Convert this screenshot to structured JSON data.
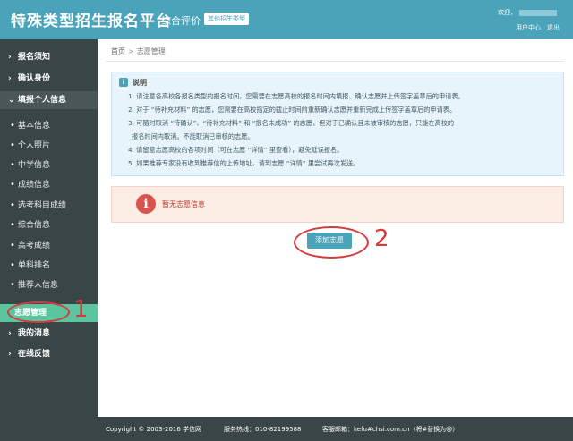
{
  "header": {
    "title": "特殊类型招生报名平台",
    "eval_label": "综合评价",
    "switch_type_label": "其他招生类型",
    "welcome_label": "欢迎，",
    "user_center_label": "用户中心",
    "logout_label": "退出"
  },
  "sidebar": {
    "items": [
      {
        "label": "报名须知",
        "kind": "top"
      },
      {
        "label": "确认身份",
        "kind": "top"
      },
      {
        "label": "填报个人信息",
        "kind": "top"
      },
      {
        "label": "基本信息",
        "kind": "sub"
      },
      {
        "label": "个人照片",
        "kind": "sub"
      },
      {
        "label": "中学信息",
        "kind": "sub"
      },
      {
        "label": "成绩信息",
        "kind": "sub"
      },
      {
        "label": "选考科目成绩",
        "kind": "sub"
      },
      {
        "label": "综合信息",
        "kind": "sub"
      },
      {
        "label": "高考成绩",
        "kind": "sub"
      },
      {
        "label": "单科排名",
        "kind": "sub"
      },
      {
        "label": "推荐人信息",
        "kind": "sub"
      },
      {
        "label": "志愿管理",
        "kind": "active"
      },
      {
        "label": "我的消息",
        "kind": "top"
      },
      {
        "label": "在线反馈",
        "kind": "top"
      }
    ]
  },
  "breadcrumb": {
    "home": "首页",
    "separator": ">",
    "current": "志愿管理"
  },
  "notice": {
    "title": "说明",
    "lines": [
      "1. 请注意各高校各报名类型的报名时间，您需要在志愿高校的报名时间内填报、确认志愿并上传签字盖章后的申请表。",
      "2. 对于 “待补充材料” 的志愿，您需要在高校指定的截止时间前重新确认志愿并重新完成上传签字盖章后的申请表。",
      "3. 可随时取消 “待确认”、“待补充材料” 和 “报名未成功” 的志愿，但对于已确认且未被审核的志愿，只能在高校的",
      "报名时间内取消。不能取消已审核的志愿。",
      "4. 请留意志愿高校的各项时间（可在志愿 “详情” 里查看），避免延误报名。",
      "5. 如果推荐专家没有收到推荐信的上传地址，请到志愿 “详情” 里尝试再次发送。"
    ]
  },
  "empty_state": {
    "text": "暂无志愿信息"
  },
  "add_button": {
    "label": "添加志愿"
  },
  "annotations": {
    "one": "1",
    "two": "2"
  },
  "footer": {
    "copyright": "Copyright © 2003-2016 学信网",
    "hotline": "服务热线：010-82199588",
    "email": "客服邮箱：kefu#chsi.com.cn（将#替换为@）"
  },
  "colors": {
    "header": "#4aa3b8",
    "sidebar": "#3a4547",
    "active_item": "#5cc5a0",
    "annotation": "#d63a3a",
    "warning": "#d9534f"
  }
}
